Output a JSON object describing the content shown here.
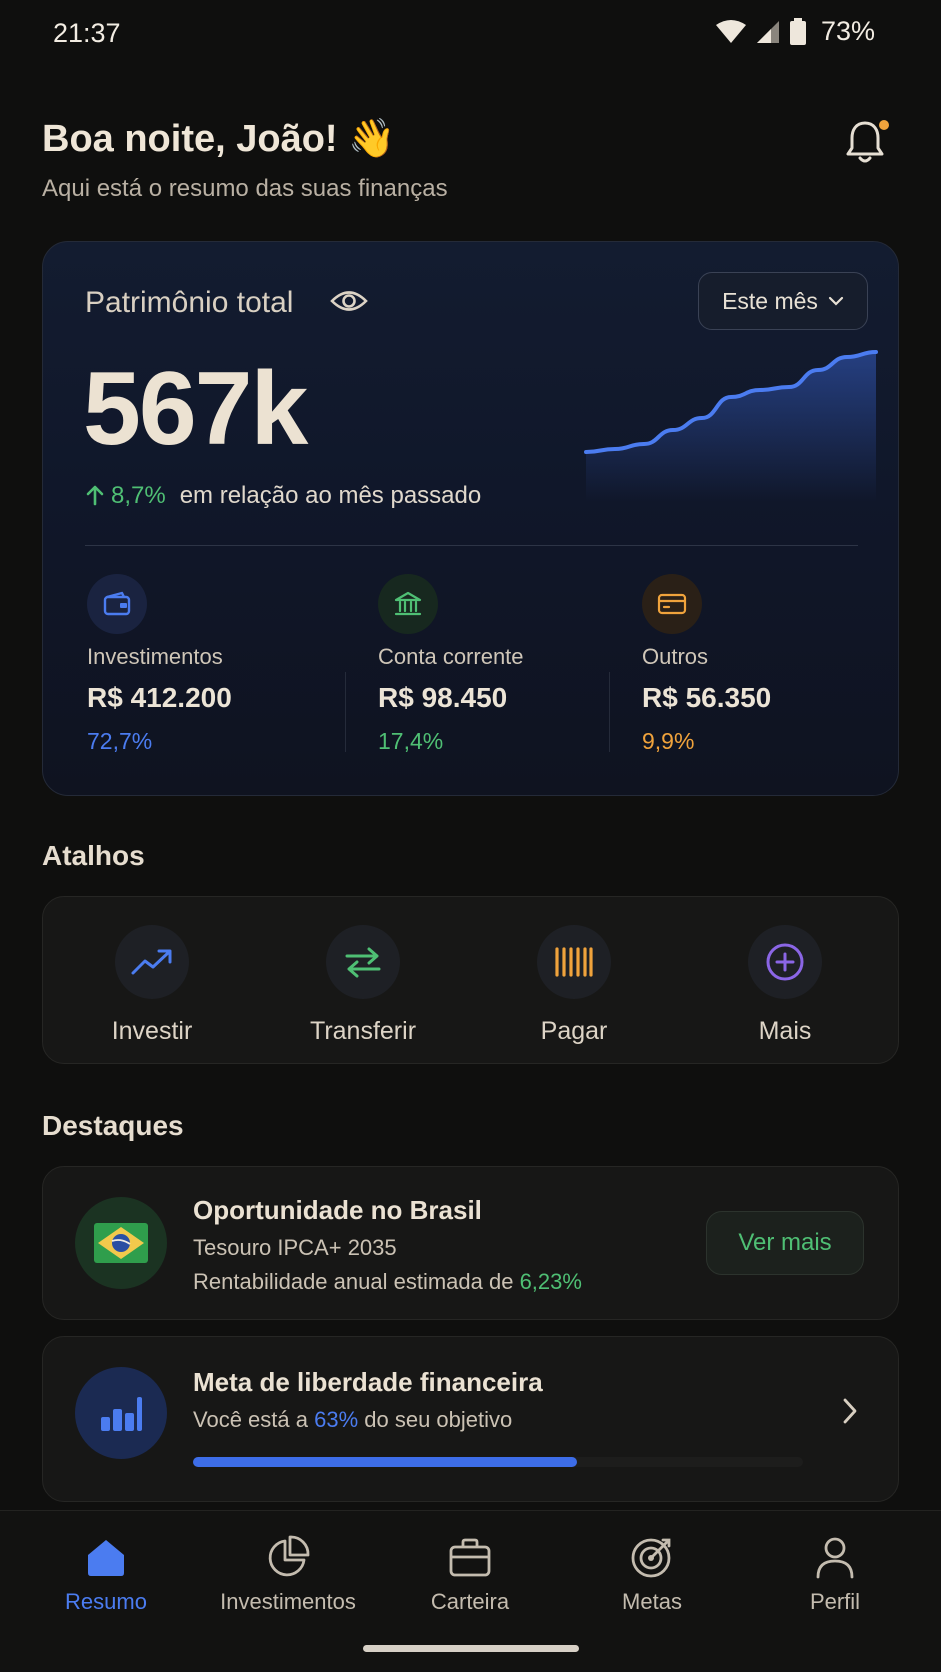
{
  "status_bar": {
    "time": "21:37",
    "battery": "73%"
  },
  "header": {
    "greeting": "Boa noite, João! 👋",
    "subtitle": "Aqui está o resumo das suas finanças"
  },
  "wealth": {
    "label": "Patrimônio total",
    "period": "Este mês",
    "value": "567k",
    "change": "8,7%",
    "change_text": "em relação ao mês passado",
    "colors": {
      "investments": "#4b7cf0",
      "checking": "#4fbf74",
      "others": "#f0a33c"
    },
    "trend_shape": [
      0.0,
      0.03,
      0.08,
      0.22,
      0.34,
      0.55,
      0.62,
      0.65,
      0.82,
      0.95,
      1.0
    ],
    "segments": [
      {
        "name": "Investimentos",
        "value": "R$ 412.200",
        "pct": "72,7%"
      },
      {
        "name": "Conta corrente",
        "value": "R$ 98.450",
        "pct": "17,4%"
      },
      {
        "name": "Outros",
        "value": "R$ 56.350",
        "pct": "9,9%"
      }
    ]
  },
  "shortcuts": {
    "title": "Atalhos",
    "items": [
      {
        "label": "Investir",
        "icon": "trending-up-icon"
      },
      {
        "label": "Transferir",
        "icon": "transfer-icon"
      },
      {
        "label": "Pagar",
        "icon": "barcode-icon"
      },
      {
        "label": "Mais",
        "icon": "plus-circle-icon"
      }
    ]
  },
  "highlights": {
    "title": "Destaques",
    "opportunity": {
      "title": "Oportunidade no Brasil",
      "product": "Tesouro IPCA+ 2035",
      "rate_text": "Rentabilidade anual estimada de ",
      "rate": "6,23%",
      "button": "Ver mais"
    },
    "goal": {
      "title": "Meta de liberdade financeira",
      "progress_prefix": "Você está a ",
      "progress_pct": "63%",
      "progress_suffix": " do seu objetivo",
      "progress_value": 0.63
    }
  },
  "nav": {
    "items": [
      {
        "label": "Resumo",
        "icon": "home-icon",
        "active": true
      },
      {
        "label": "Investimentos",
        "icon": "pie-chart-icon",
        "active": false
      },
      {
        "label": "Carteira",
        "icon": "briefcase-icon",
        "active": false
      },
      {
        "label": "Metas",
        "icon": "target-icon",
        "active": false
      },
      {
        "label": "Perfil",
        "icon": "user-icon",
        "active": false
      }
    ]
  }
}
